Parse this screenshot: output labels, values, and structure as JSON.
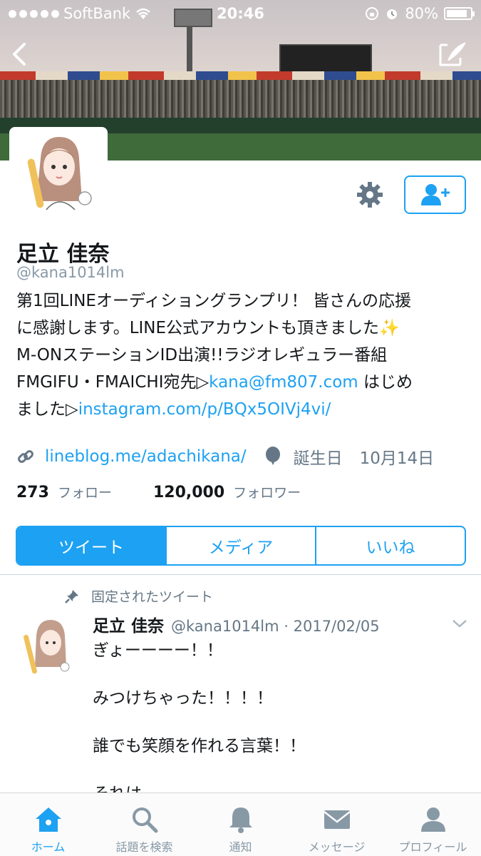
{
  "status_bar": {
    "carrier": "SoftBank",
    "time": "20:46",
    "battery": "80%"
  },
  "profile": {
    "name": "足立 佳奈",
    "handle": "@kana1014lm",
    "bio_lines": [
      "第1回LINEオーディショングランプリ！ 皆さんの応援",
      "に感謝します。LINE公式アカウントも頂きました✨",
      "M-ONステーションID出演!!ラジオレギュラー番組"
    ],
    "bio_line4_prefix": "FMGIFU・FMAICHI宛先▷",
    "bio_email": "kana@fm807.com",
    "bio_line4_suffix": " はじめ",
    "bio_line5_prefix": "ました▷",
    "bio_instagram": "instagram.com/p/BQx5OIVj4vi/",
    "url": "lineblog.me/adachikana/",
    "birthday_label": "誕生日",
    "birthday": "10月14日",
    "following_count": "273",
    "following_label": "フォロー",
    "followers_count": "120,000",
    "followers_label": "フォロワー"
  },
  "tabs": [
    {
      "label": "ツイート",
      "active": true
    },
    {
      "label": "メディア",
      "active": false
    },
    {
      "label": "いいね",
      "active": false
    }
  ],
  "pinned_tweet": {
    "pinned_label": "固定されたツイート",
    "name": "足立 佳奈",
    "meta": "@kana1014lm · 2017/02/05",
    "lines": [
      "ぎょーーーー！！",
      "みつけちゃった！！！！",
      "誰でも笑顔を作れる言葉！！",
      "それは"
    ]
  },
  "tabbar": [
    {
      "label": "ホーム",
      "icon": "home-icon",
      "active": true
    },
    {
      "label": "話題を検索",
      "icon": "search-icon",
      "active": false
    },
    {
      "label": "通知",
      "icon": "bell-icon",
      "active": false
    },
    {
      "label": "メッセージ",
      "icon": "envelope-icon",
      "active": false
    },
    {
      "label": "プロフィール",
      "icon": "person-icon",
      "active": false
    }
  ],
  "colors": {
    "accent": "#1da1f2",
    "secondary_text": "#657786"
  }
}
